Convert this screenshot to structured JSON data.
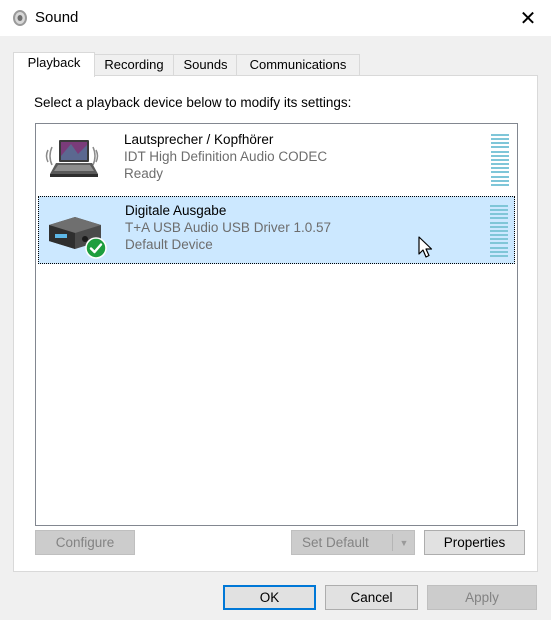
{
  "window": {
    "title": "Sound",
    "close_symbol": "✕"
  },
  "tabs": [
    {
      "label": "Playback",
      "active": true
    },
    {
      "label": "Recording",
      "active": false
    },
    {
      "label": "Sounds",
      "active": false
    },
    {
      "label": "Communications",
      "active": false
    }
  ],
  "playback": {
    "instruction": "Select a playback device below to modify its settings:",
    "devices": [
      {
        "name": "Lautsprecher / Kopfhörer",
        "driver": "IDT High Definition Audio CODEC",
        "status": "Ready",
        "icon": "laptop-speaker-icon",
        "selected": false
      },
      {
        "name": "Digitale Ausgabe",
        "driver": "T+A USB Audio USB Driver 1.0.57",
        "status": "Default Device",
        "icon": "usb-audio-device-icon",
        "default_badge": "checkmark-icon",
        "selected": true
      }
    ],
    "buttons": {
      "configure": "Configure",
      "set_default": "Set Default",
      "properties": "Properties"
    }
  },
  "footer": {
    "ok": "OK",
    "cancel": "Cancel",
    "apply": "Apply"
  },
  "colors": {
    "selection": "#cce8ff",
    "accent": "#0078d7",
    "meter": "#7fc6d8",
    "default_badge": "#1e9e3e"
  }
}
